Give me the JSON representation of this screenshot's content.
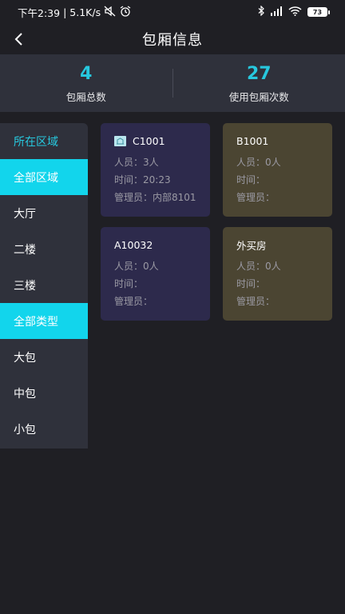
{
  "status_bar": {
    "time": "下午2:39",
    "speed": "5.1K/s",
    "battery": "73"
  },
  "header": {
    "title": "包厢信息"
  },
  "summary": {
    "total_value": "4",
    "total_label": "包厢总数",
    "used_value": "27",
    "used_label": "使用包厢次数"
  },
  "sidebar": {
    "area_header": "所在区域",
    "areas": [
      "全部区域",
      "大厅",
      "二楼",
      "三楼"
    ],
    "types": [
      "全部类型",
      "大包",
      "中包",
      "小包"
    ]
  },
  "labels": {
    "persons": "人员：",
    "time": "时间：",
    "manager": "管理员："
  },
  "rooms": [
    {
      "name": "C1001",
      "persons": "3人",
      "time": "20:23",
      "manager": "内部8101",
      "color": "#2d2a4c",
      "has_icon": true
    },
    {
      "name": "B1001",
      "persons": "0人",
      "time": "",
      "manager": "",
      "color": "#4b4532",
      "has_icon": false
    },
    {
      "name": "A10032",
      "persons": "0人",
      "time": "",
      "manager": "",
      "color": "#2d2a4c",
      "has_icon": false
    },
    {
      "name": "外买房",
      "persons": "0人",
      "time": "",
      "manager": "",
      "color": "#4b4532",
      "has_icon": false
    }
  ],
  "colors": {
    "accent": "#27c8de",
    "active_bg": "#12d5ec",
    "panel_bg": "#2f313b",
    "page_bg": "#1f1f24"
  }
}
